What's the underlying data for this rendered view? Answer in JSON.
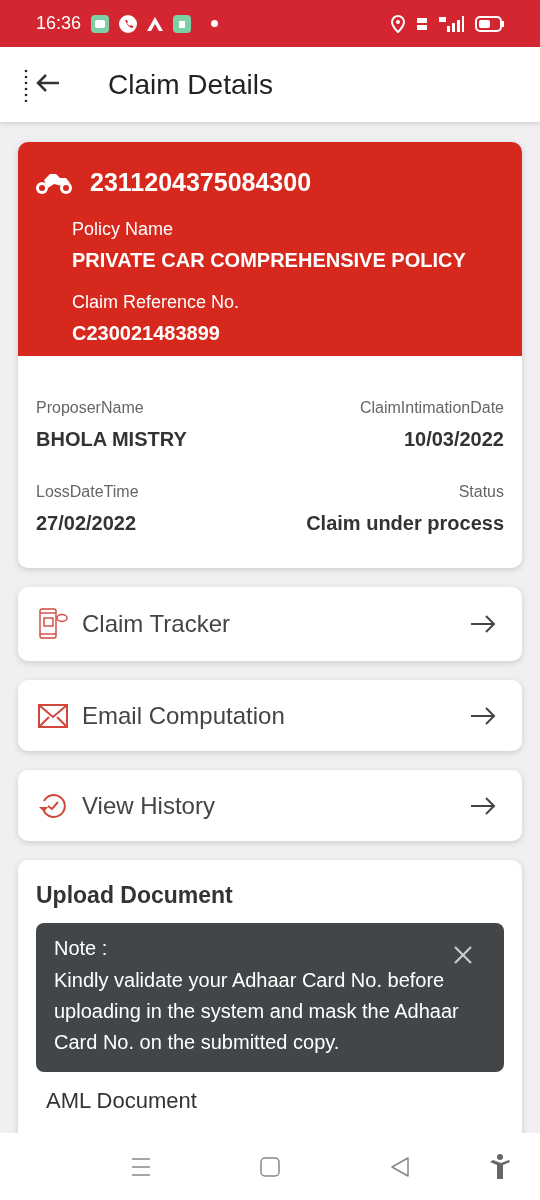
{
  "status_bar": {
    "time": "16:36"
  },
  "header": {
    "title": "Claim Details"
  },
  "claim_card": {
    "number": "2311204375084300",
    "policy_name_label": "Policy Name",
    "policy_name": "PRIVATE CAR COMPREHENSIVE POLICY",
    "claim_ref_label": "Claim Reference No.",
    "claim_ref": "C230021483899",
    "fields": [
      {
        "label": "ProposerName",
        "value": "BHOLA MISTRY"
      },
      {
        "label": "ClaimIntimationDate",
        "value": "10/03/2022"
      },
      {
        "label": "LossDateTime",
        "value": "27/02/2022"
      },
      {
        "label": "Status",
        "value": "Claim under process"
      }
    ]
  },
  "actions": [
    {
      "kind": "tracker",
      "label": "Claim Tracker"
    },
    {
      "kind": "email",
      "label": "Email Computation"
    },
    {
      "kind": "history",
      "label": "View History"
    }
  ],
  "upload": {
    "title": "Upload Document",
    "note_title": "Note :",
    "note_text": "Kindly validate your Adhaar Card No. before uploading in the system and mask the Adhaar Card No. on the submitted copy.",
    "documents": [
      "AML Document"
    ]
  }
}
